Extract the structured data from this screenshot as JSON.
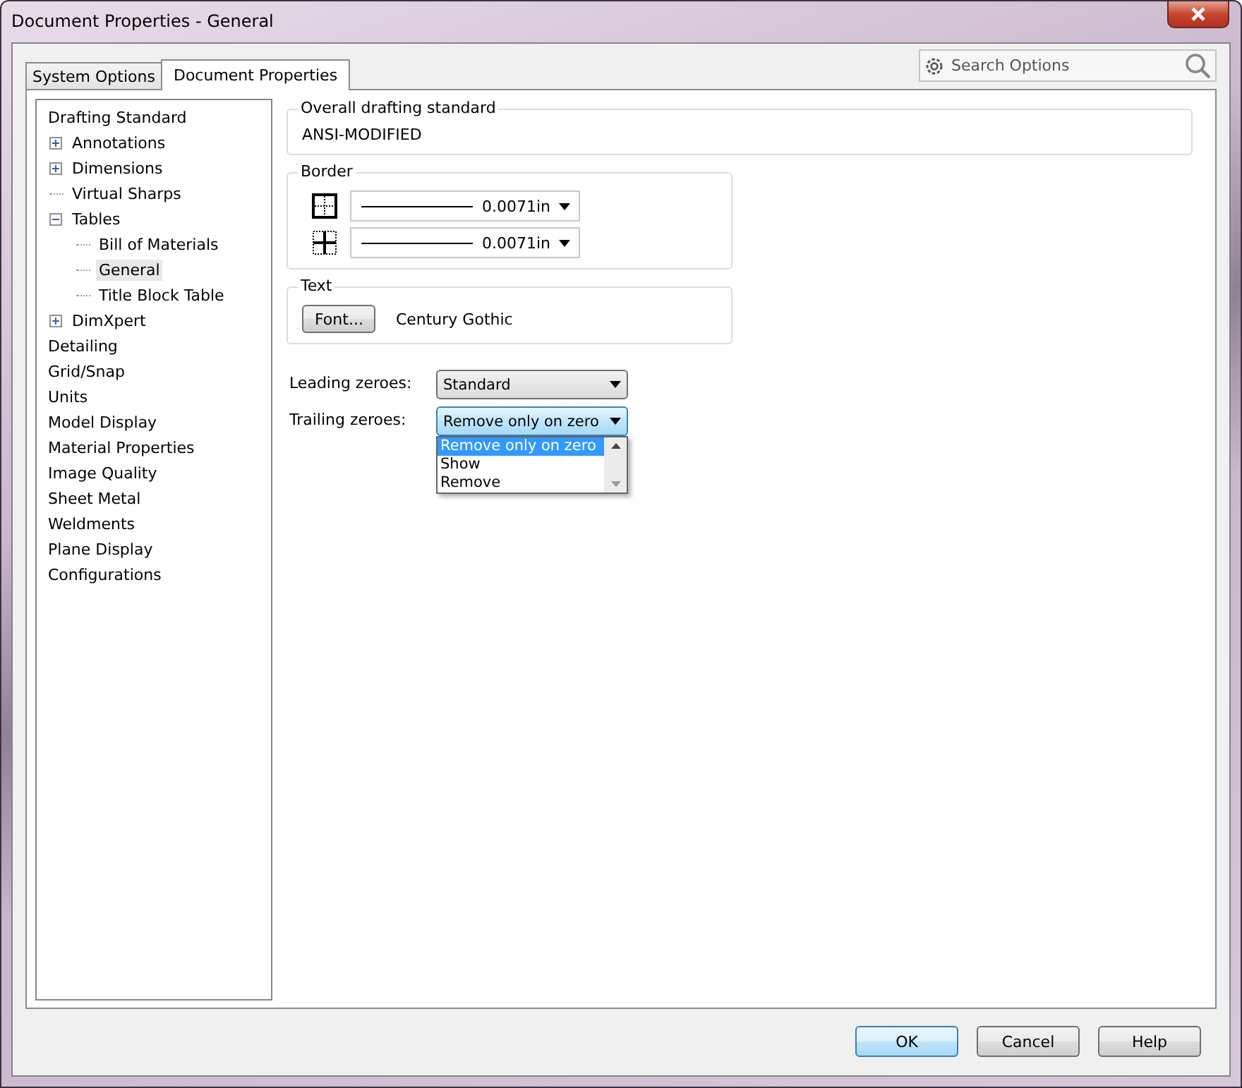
{
  "window": {
    "title": "Document Properties - General"
  },
  "tabs": [
    {
      "label": "System Options",
      "selected": false
    },
    {
      "label": "Document Properties",
      "selected": true
    }
  ],
  "search": {
    "placeholder": "Search Options"
  },
  "tree": [
    {
      "label": "Drafting Standard",
      "selected": false,
      "children": [
        {
          "label": "Annotations",
          "expanded": false,
          "selected": false
        },
        {
          "label": "Dimensions",
          "expanded": false,
          "selected": false
        },
        {
          "label": "Virtual Sharps",
          "selected": false
        },
        {
          "label": "Tables",
          "expanded": true,
          "selected": false,
          "children": [
            {
              "label": "Bill of Materials",
              "selected": false
            },
            {
              "label": "General",
              "selected": true
            },
            {
              "label": "Title Block Table",
              "selected": false
            }
          ]
        },
        {
          "label": "DimXpert",
          "expanded": false,
          "selected": false
        }
      ]
    },
    {
      "label": "Detailing",
      "selected": false
    },
    {
      "label": "Grid/Snap",
      "selected": false
    },
    {
      "label": "Units",
      "selected": false
    },
    {
      "label": "Model Display",
      "selected": false
    },
    {
      "label": "Material Properties",
      "selected": false
    },
    {
      "label": "Image Quality",
      "selected": false
    },
    {
      "label": "Sheet Metal",
      "selected": false
    },
    {
      "label": "Weldments",
      "selected": false
    },
    {
      "label": "Plane Display",
      "selected": false
    },
    {
      "label": "Configurations",
      "selected": false
    }
  ],
  "overall_standard": {
    "label": "Overall drafting standard",
    "value": "ANSI-MODIFIED"
  },
  "border": {
    "label": "Border",
    "rows": [
      {
        "kind": "outer",
        "value": "0.0071in"
      },
      {
        "kind": "inner",
        "value": "0.0071in"
      }
    ]
  },
  "text": {
    "label": "Text",
    "button": "Font...",
    "font": "Century Gothic"
  },
  "fields": [
    {
      "label": "Leading zeroes:",
      "value": "Standard",
      "open": false
    },
    {
      "label": "Trailing zeroes:",
      "value": "Remove only on zero",
      "open": true,
      "options": [
        {
          "label": "Remove only on zero",
          "selected": true
        },
        {
          "label": "Show",
          "selected": false
        },
        {
          "label": "Remove",
          "selected": false
        }
      ]
    }
  ],
  "buttons": [
    {
      "label": "OK",
      "default": true
    },
    {
      "label": "Cancel",
      "default": false
    },
    {
      "label": "Help",
      "default": false
    }
  ]
}
